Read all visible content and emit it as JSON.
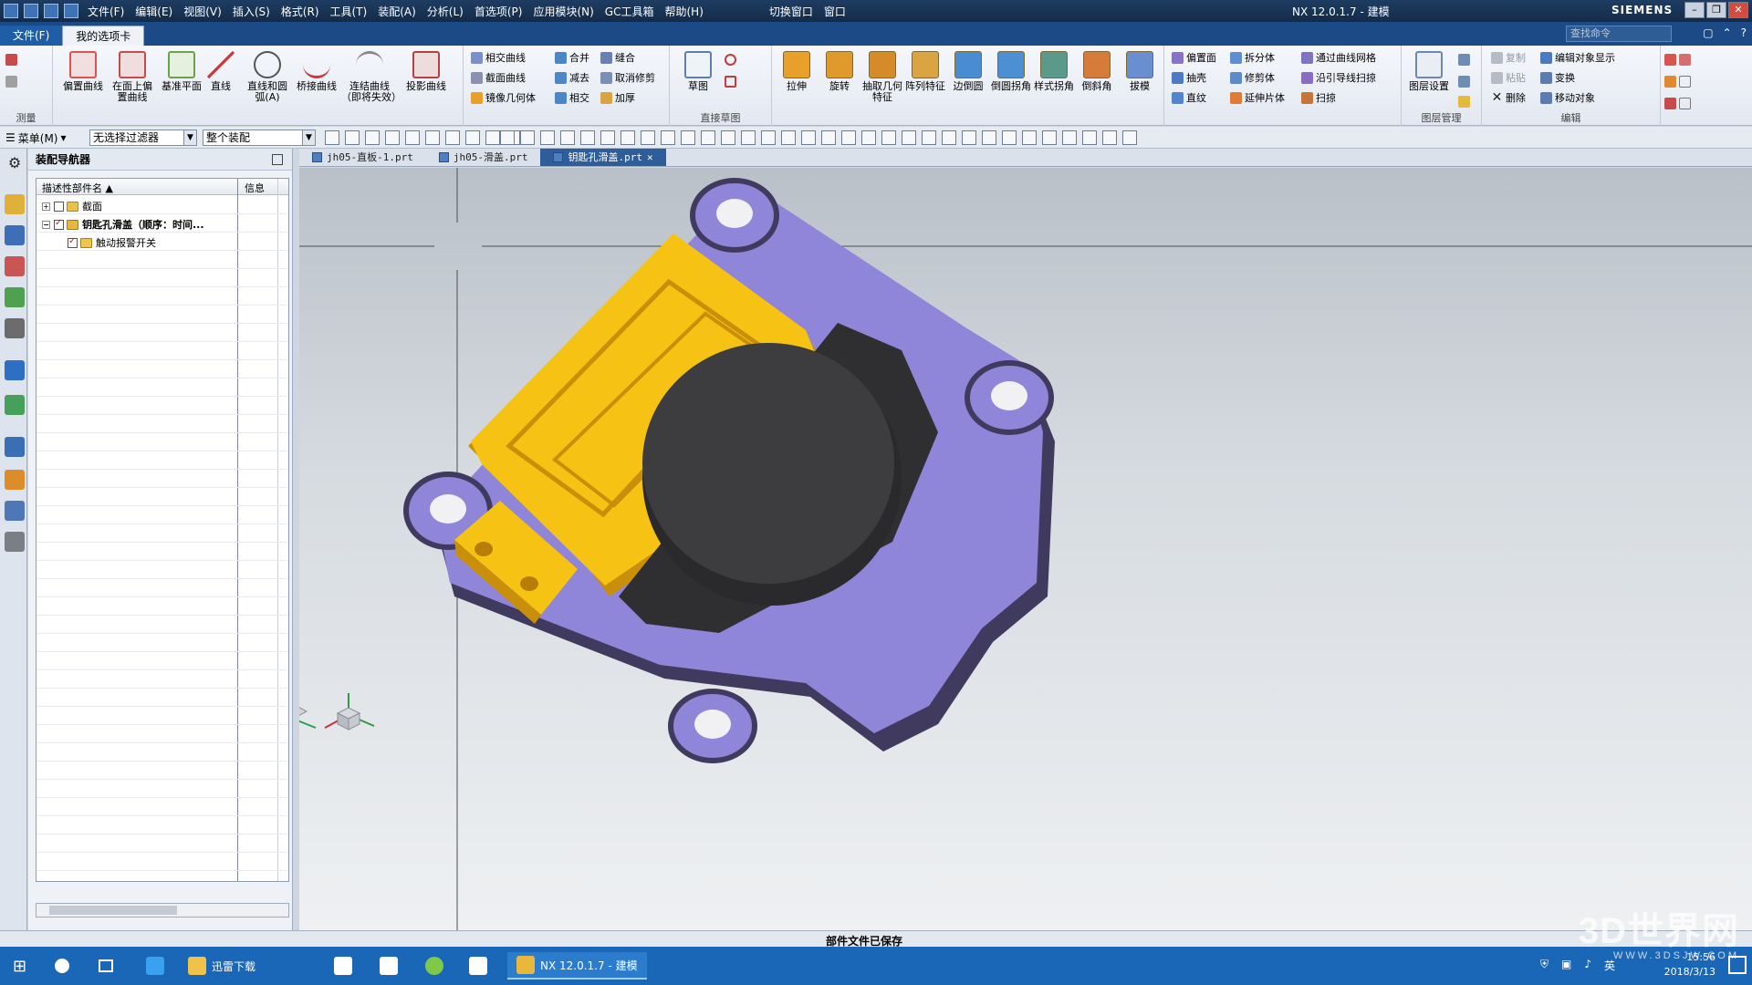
{
  "titlebar": {
    "menus": [
      "文件(F)",
      "编辑(E)",
      "视图(V)",
      "插入(S)",
      "格式(R)",
      "工具(T)",
      "装配(A)",
      "分析(L)",
      "首选项(P)",
      "应用模块(N)",
      "GC工具箱",
      "帮助(H)"
    ],
    "switch_window": "切换窗口",
    "window_menu": "窗口",
    "title": "NX 12.0.1.7 - 建模",
    "brand": "SIEMENS"
  },
  "ribbontabs": {
    "file": "文件(F)",
    "my_tab": "我的选项卡",
    "search_placeholder": "查找命令"
  },
  "ribbon": {
    "measure_group": "测量",
    "big_buttons": [
      {
        "label": "偏置曲线",
        "icon": "offset-curve-icon",
        "color": "#d9534f"
      },
      {
        "label": "在面上偏置曲线",
        "icon": "offset-in-face-icon",
        "color": "#c94a4a"
      },
      {
        "label": "基准平面",
        "icon": "datum-plane-icon",
        "color": "#6ba34d"
      },
      {
        "label": "直线",
        "icon": "line-icon",
        "color": "#c43b3b"
      },
      {
        "label": "直线和圆弧(A)",
        "icon": "arc-icon",
        "color": "#555555"
      },
      {
        "label": "桥接曲线",
        "icon": "bridge-curve-icon",
        "color": "#c43b3b"
      },
      {
        "label": "连结曲线（即将失效）",
        "icon": "join-curve-icon",
        "color": "#8a8a8a"
      },
      {
        "label": "投影曲线",
        "icon": "project-curve-icon",
        "color": "#b44141"
      }
    ],
    "curve_small": [
      "相交曲线",
      "截面曲线",
      "镜像几何体"
    ],
    "bool_small": [
      "合并",
      "减去",
      "相交"
    ],
    "sew_small": [
      "缝合",
      "取消修剪",
      "加厚"
    ],
    "sketch_label": "草图",
    "direct_sketch": "直接草图",
    "feature_buttons": [
      {
        "label": "拉伸",
        "color": "#e8a02a"
      },
      {
        "label": "旋转",
        "color": "#e09a2c"
      },
      {
        "label": "抽取几何特征",
        "color": "#d68b2a"
      },
      {
        "label": "阵列特征",
        "color": "#d9a441"
      },
      {
        "label": "边倒圆",
        "color": "#4a8cd1"
      },
      {
        "label": "倒圆拐角",
        "color": "#4d8fd3"
      },
      {
        "label": "样式拐角",
        "color": "#5b9a8a"
      },
      {
        "label": "倒斜角",
        "color": "#d67b3a"
      },
      {
        "label": "拔模",
        "color": "#6a8fd1"
      }
    ],
    "surface_small_1": [
      "偏置面",
      "抽壳",
      "直纹"
    ],
    "surface_small_2": [
      "拆分体",
      "修剪体",
      "延伸片体"
    ],
    "surface_small_3": [
      "通过曲线网格",
      "沿引导线扫掠",
      "扫掠"
    ],
    "layer_settings": "图层设置",
    "layer_group": "图层管理",
    "edit_small_1": [
      "复制",
      "粘贴",
      "删除"
    ],
    "edit_small_2": [
      "编辑对象显示",
      "变换",
      "移动对象"
    ],
    "edit_group": "编辑"
  },
  "toolbar2": {
    "menu": "菜单(M)",
    "filter": "无选择过滤器",
    "assembly": "整个装配"
  },
  "navigator": {
    "title": "装配导航器",
    "col_name": "描述性部件名",
    "col_info": "信息",
    "rows": [
      {
        "label": "截面",
        "checked": false,
        "level": 0
      },
      {
        "label": "钥匙孔滑盖（顺序：时间...",
        "checked": true,
        "level": 0
      },
      {
        "label": "触动报警开关",
        "checked": true,
        "level": 1
      }
    ]
  },
  "doctabs": [
    {
      "label": "jh05-直板-1.prt",
      "active": false
    },
    {
      "label": "jh05-滑盖.prt",
      "active": false
    },
    {
      "label": "钥匙孔滑盖.prt",
      "active": true
    }
  ],
  "status": {
    "message": "部件文件已保存"
  },
  "taskbar": {
    "apps": [
      "迅雷下载",
      "NX 12.0.1.7 - 建模"
    ],
    "time": "15:56",
    "date": "2018/3/13",
    "lang": "英"
  },
  "watermark": {
    "text": "3D世界网",
    "url": "WWW.3DSJW.COM"
  },
  "colors": {
    "housing": "#8f85d9",
    "housing_dark": "#3f3a5e",
    "cover": "#f6c314",
    "cover_dark": "#c98e0a",
    "motor": "#3d3d3f",
    "ribbon_tab": "#1b4a86"
  }
}
